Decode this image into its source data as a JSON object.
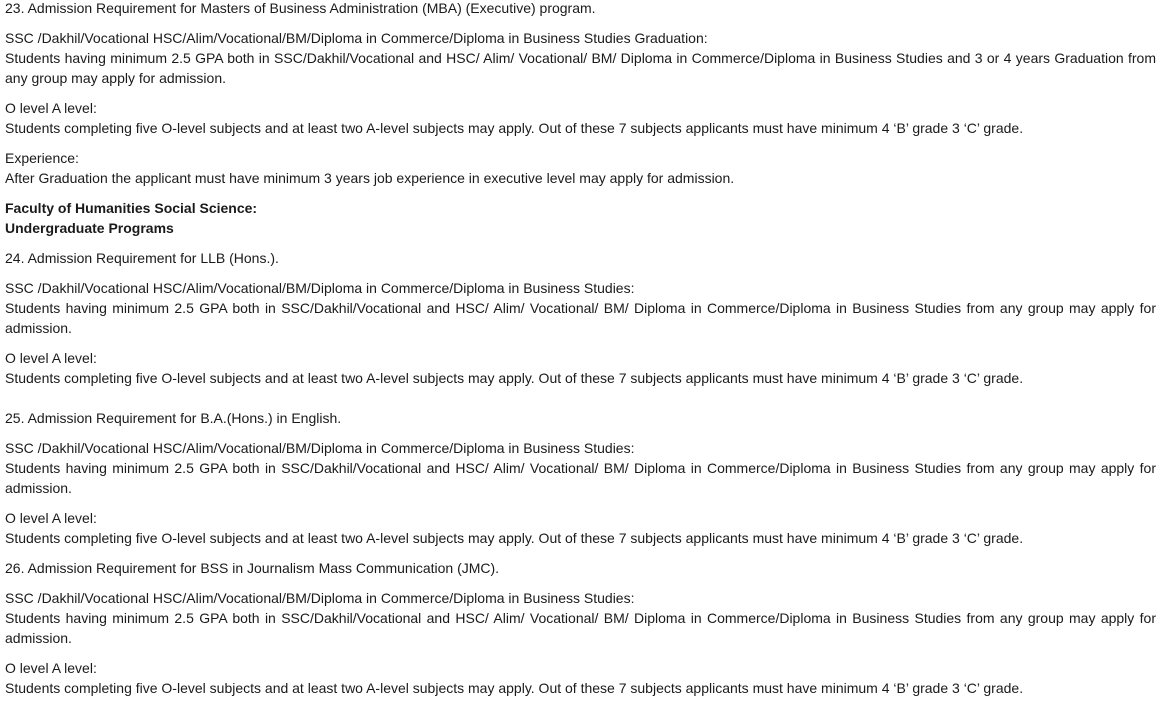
{
  "sections": {
    "mba_exec": {
      "title": "23. Admission Requirement for Masters of Business Administration (MBA) (Executive) program.",
      "ssc_heading": "SSC /Dakhil/Vocational HSC/Alim/Vocational/BM/Diploma in Commerce/Diploma in Business Studies Graduation:",
      "ssc_text": "Students having minimum 2.5 GPA both in SSC/Dakhil/Vocational and HSC/ Alim/ Vocational/ BM/ Diploma in Commerce/Diploma in Business Studies and 3 or 4 years Graduation from any group may apply for admission.",
      "olevel_heading": "O level A level:",
      "olevel_text": "Students completing five O-level subjects and at least two A-level subjects may apply. Out of these 7 subjects applicants must have minimum 4 ‘B’ grade 3 ‘C’ grade.",
      "experience_heading": "Experience:",
      "experience_text": "After Graduation the applicant must have minimum 3 years job experience in executive level may apply for admission."
    },
    "faculty": {
      "name": "Faculty of Humanities Social Science:",
      "subheading": "Undergraduate Programs"
    },
    "llb": {
      "title": "24. Admission Requirement for LLB (Hons.).",
      "ssc_heading": "SSC /Dakhil/Vocational HSC/Alim/Vocational/BM/Diploma in Commerce/Diploma in Business Studies:",
      "ssc_text": "Students having minimum 2.5 GPA both in SSC/Dakhil/Vocational and HSC/ Alim/ Vocational/ BM/ Diploma in Commerce/Diploma in Business Studies from any group may apply for admission.",
      "olevel_heading": "O level A level:",
      "olevel_text": "Students completing five O-level subjects and at least two A-level subjects may apply. Out of these 7 subjects applicants must have minimum 4 ‘B’ grade 3 ‘C’ grade."
    },
    "ba_english": {
      "title": "25. Admission Requirement for B.A.(Hons.) in English.",
      "ssc_heading": "SSC /Dakhil/Vocational HSC/Alim/Vocational/BM/Diploma in Commerce/Diploma in Business Studies:",
      "ssc_text": "Students having minimum 2.5 GPA both in SSC/Dakhil/Vocational and HSC/ Alim/ Vocational/ BM/ Diploma in Commerce/Diploma in Business Studies from any group may apply for admission.",
      "olevel_heading": "O level A level:",
      "olevel_text": "Students completing five O-level subjects and at least two A-level subjects may apply. Out of these 7 subjects applicants must have minimum 4 ‘B’ grade 3 ‘C’ grade."
    },
    "bss_jmc": {
      "title": "26. Admission Requirement for BSS in Journalism Mass Communication (JMC).",
      "ssc_heading": "SSC /Dakhil/Vocational HSC/Alim/Vocational/BM/Diploma in Commerce/Diploma in Business Studies:",
      "ssc_text": "Students having minimum 2.5 GPA both in SSC/Dakhil/Vocational and HSC/ Alim/ Vocational/ BM/ Diploma in Commerce/Diploma in Business Studies from any group may apply for admission.",
      "olevel_heading": "O level A level:",
      "olevel_text": "Students completing five O-level subjects and at least two A-level subjects may apply. Out of these 7 subjects applicants must have minimum 4 ‘B’ grade 3 ‘C’ grade."
    }
  }
}
